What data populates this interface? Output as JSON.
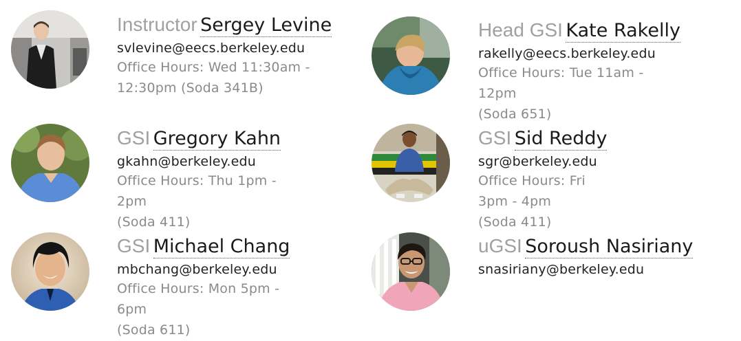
{
  "staff": [
    {
      "role": "Instructor",
      "name": "Sergey Levine",
      "email": "svlevine@eecs.berkeley.edu",
      "hours": "Office Hours: Wed 11:30am -",
      "location": "12:30pm (Soda 341B)"
    },
    {
      "role": "Head GSI",
      "name": "Kate Rakelly",
      "email": "rakelly@eecs.berkeley.edu",
      "hours": "Office Hours: Tue 11am - 12pm",
      "location": "(Soda 651)"
    },
    {
      "role": "GSI",
      "name": "Gregory Kahn",
      "email": "gkahn@berkeley.edu",
      "hours": "Office Hours: Thu 1pm - 2pm",
      "location": "(Soda 411)"
    },
    {
      "role": "GSI",
      "name": "Sid Reddy",
      "email": "sgr@berkeley.edu",
      "hours": "Office Hours: Fri 3pm - 4pm",
      "location": "(Soda 411)"
    },
    {
      "role": "GSI",
      "name": "Michael Chang",
      "email": "mbchang@berkeley.edu",
      "hours": "Office Hours: Mon 5pm - 6pm",
      "location": "(Soda 611)"
    },
    {
      "role": "uGSI",
      "name": "Soroush Nasiriany",
      "email": "snasiriany@berkeley.edu"
    }
  ],
  "colors": {
    "role": "#a0a0a0",
    "name": "#1a1a1a",
    "email": "#222222",
    "hours": "#8a8a8a"
  }
}
